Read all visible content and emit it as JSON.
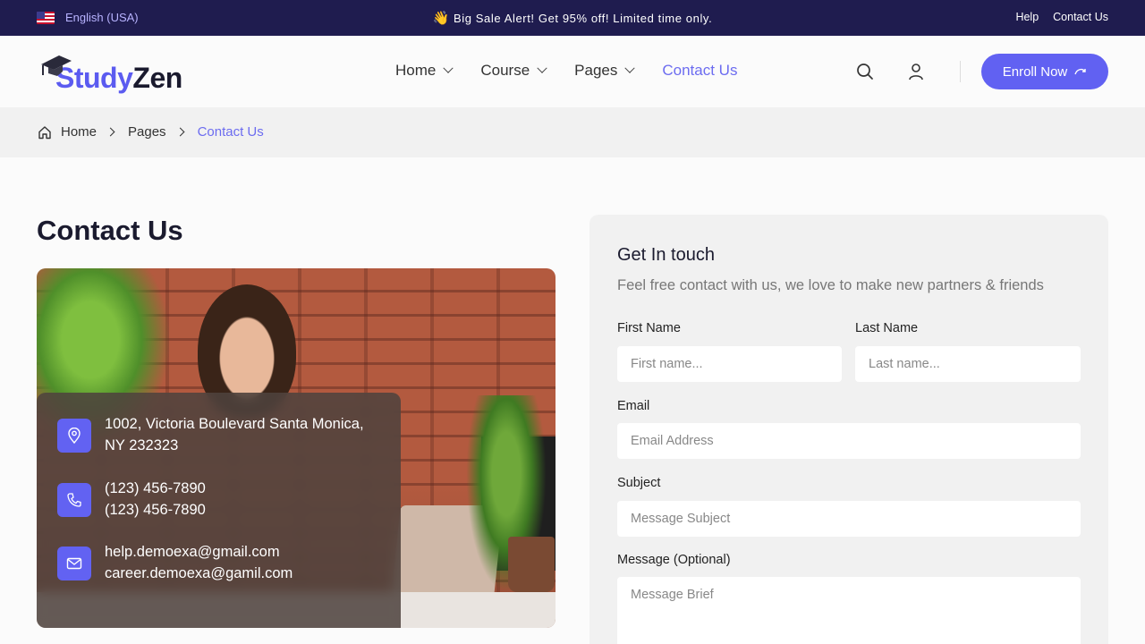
{
  "topbar": {
    "language": "English (USA)",
    "alert_emoji": "👋",
    "alert": "Big Sale Alert! Get 95% off! Limited time only.",
    "links": [
      "Help",
      "Contact Us"
    ]
  },
  "header": {
    "logo_part1": "Study",
    "logo_part2": "Zen",
    "nav": [
      {
        "label": "Home",
        "dropdown": true
      },
      {
        "label": "Course",
        "dropdown": true
      },
      {
        "label": "Pages",
        "dropdown": true
      },
      {
        "label": "Contact Us",
        "dropdown": false,
        "active": true
      }
    ],
    "enroll_label": "Enroll Now",
    "accent": "#6161f2"
  },
  "breadcrumb": [
    "Home",
    "Pages",
    "Contact Us"
  ],
  "contact": {
    "title": "Contact Us",
    "address_line1": "1002, Victoria Boulevard Santa Monica,",
    "address_line2": "NY 232323",
    "phone1": "(123) 456-7890",
    "phone2": "(123) 456-7890",
    "email1": "help.demoexa@gmail.com",
    "email2": "career.demoexa@gamil.com"
  },
  "form": {
    "title": "Get In touch",
    "subtitle": "Feel free contact with us, we love to make new partners & friends",
    "first_name_label": "First Name",
    "first_name_placeholder": "First name...",
    "last_name_label": "Last Name",
    "last_name_placeholder": "Last name...",
    "email_label": "Email",
    "email_placeholder": "Email Address",
    "subject_label": "Subject",
    "subject_placeholder": "Message Subject",
    "message_label": "Message (Optional)",
    "message_placeholder": "Message Brief"
  }
}
